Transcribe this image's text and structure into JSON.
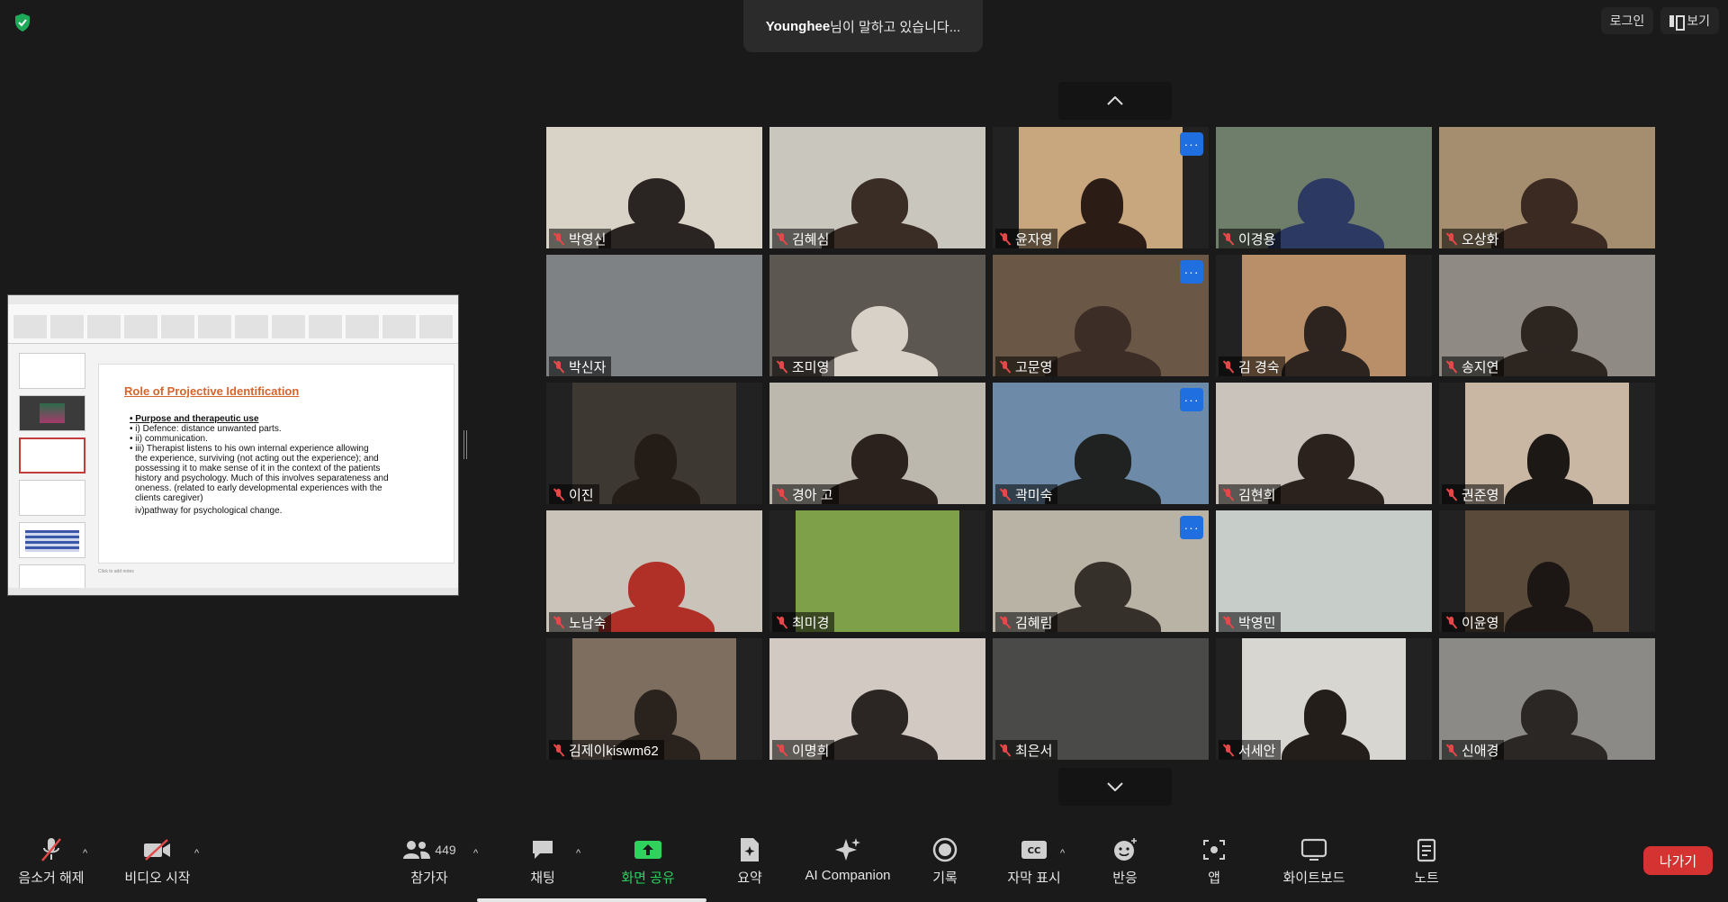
{
  "header": {
    "speaking_name": "Younghee",
    "speaking_suffix": "님이 말하고 있습니다...",
    "login_label": "로그인",
    "view_label": "보기"
  },
  "shared_slide": {
    "title": "Role of Projective Identification",
    "lines": [
      "• Purpose and therapeutic use",
      "• i)  Defence: distance unwanted parts.",
      "• ii)  communication.",
      "• iii) Therapist listens to his own internal experience allowing",
      "the experience, surviving (not acting out the experience); and",
      "possessing it to make sense of it in the context of the patients",
      "history and psychology. Much of this involves separateness and",
      "oneness. (related to early developmental experiences with the",
      "clients caregiver)",
      "iv)pathway for psychological change."
    ],
    "notes_placeholder": "Click to add notes"
  },
  "participants": [
    {
      "name": "박영신",
      "bg": "#d9d2c6",
      "person": "#2a2522"
    },
    {
      "name": "김혜심",
      "bg": "#c9c6bd",
      "person": "#3a2d26"
    },
    {
      "name": "윤자영",
      "bg": "#c9a77e",
      "person": "#2b1d15",
      "more": true
    },
    {
      "name": "이경용",
      "bg": "#6f7d6b",
      "person": "#2c3a63"
    },
    {
      "name": "오상화",
      "bg": "#a58e6f",
      "person": "#3b2a22"
    },
    {
      "name": "박신자",
      "bg": "#7f8285",
      "person": ""
    },
    {
      "name": "조미영",
      "bg": "#5d5751",
      "person": "#d7d1c8"
    },
    {
      "name": "고문영",
      "bg": "#6b5745",
      "person": "#3c2e26",
      "more": true
    },
    {
      "name": "김 경숙",
      "bg": "#b88f69",
      "person": "#2d2420"
    },
    {
      "name": "송지연",
      "bg": "#8f8a83",
      "person": "#2c2520"
    },
    {
      "name": "이진",
      "bg": "#3e3833",
      "person": "#241c17"
    },
    {
      "name": "경아 고",
      "bg": "#bdb8ae",
      "person": "#2b221d"
    },
    {
      "name": "곽미숙",
      "bg": "#6d8aa8",
      "person": "#1f2220",
      "more": true
    },
    {
      "name": "김현희",
      "bg": "#c9c3bb",
      "person": "#2b221d"
    },
    {
      "name": "권준영",
      "bg": "#c9b7a4",
      "person": "#1c1816"
    },
    {
      "name": "노남숙",
      "bg": "#c9c3ba",
      "person": "#b03028"
    },
    {
      "name": "최미경",
      "bg": "#7ea048",
      "person": ""
    },
    {
      "name": "김혜림",
      "bg": "#b9b3a6",
      "person": "#36302b",
      "more": true
    },
    {
      "name": "박영민",
      "bg": "#c7cec9",
      "person": ""
    },
    {
      "name": "이윤영",
      "bg": "#5a4a3a",
      "person": "#1c1714"
    },
    {
      "name": "김제이kiswm62",
      "bg": "#7d6e5f",
      "person": "#2a221c"
    },
    {
      "name": "이명희",
      "bg": "#d1c9c2",
      "person": "#2b2623"
    },
    {
      "name": "최은서",
      "bg": "#4a4a48",
      "person": ""
    },
    {
      "name": "서세안",
      "bg": "#d8d6d1",
      "person": "#241e1a"
    },
    {
      "name": "신애경",
      "bg": "#8b8a86",
      "person": "#2b2724"
    }
  ],
  "toolbar": {
    "unmute": "음소거 해제",
    "start_video": "비디오 시작",
    "participants": "참가자",
    "participants_count": "449",
    "chat": "채팅",
    "share_screen": "화면 공유",
    "summary": "요약",
    "ai_companion": "AI Companion",
    "record": "기록",
    "captions": "자막 표시",
    "reactions": "반응",
    "apps": "앱",
    "whiteboard": "화이트보드",
    "notes": "노트",
    "leave": "나가기"
  },
  "colors": {
    "background": "#1a1a1a",
    "share_green": "#2fd25d",
    "leave_red": "#d53232",
    "muted_red": "#e24a4a",
    "slide_title": "#d4652e"
  },
  "icons": [
    "shield-icon",
    "view-icon",
    "chevron-up-icon",
    "chevron-down-icon",
    "mic-off-icon",
    "video-off-icon",
    "people-icon",
    "chat-icon",
    "share-screen-icon",
    "summary-icon",
    "sparkle-icon",
    "record-icon",
    "cc-icon",
    "emoji-icon",
    "apps-icon",
    "whiteboard-icon",
    "notes-icon"
  ]
}
